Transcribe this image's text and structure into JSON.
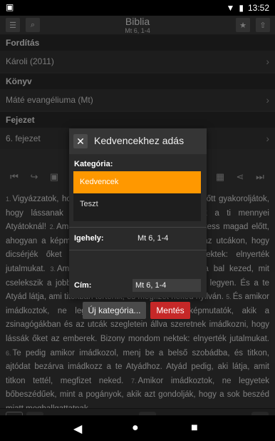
{
  "status_bar": {
    "app_icon": "android-notification-icon",
    "time": "13:52"
  },
  "toolbar": {
    "title": "Biblia",
    "subtitle": "Mt 6, 1-4"
  },
  "sections": [
    {
      "header": "Fordítás",
      "value": "Károli (2011)"
    },
    {
      "header": "Könyv",
      "value": "Máté evangéliuma (Mt)"
    },
    {
      "header": "Fejezet",
      "value": "6. fejezet"
    }
  ],
  "bible_text": [
    {
      "n": "1.",
      "t": "Vigyázzatok, hogy alamizsnátokat ne az emberek előtt gyakoroljátok, hogy lássanak titeket; különben nincs jutalmatok a ti mennyei Atyátoknál!"
    },
    {
      "n": "2.",
      "t": "Amikor tehát alamizsnát adsz, ne kürtöltess magad előtt, ahogyan a képmutatók teszik a zsinagógákban és az utcákon, hogy dicsérjék őket az emberek. Bizony mondom nektek: elnyerték jutalmukat."
    },
    {
      "n": "3.",
      "t": "Amikor te alamizsnát adsz, ne tudja a bal kezed, mit cselekszik a jobb kezed,"
    },
    {
      "n": "4.",
      "t": "hogy alamizsnád titokban legyen. És a te Atyád látja, ami titokban történik, és megfizet neked nyilván."
    },
    {
      "n": "5.",
      "t": "És amikor imádkoztok, ne legyetek olyanok, mint a képmutatók, akik a zsinagógákban és az utcák szegletein állva szeretnek imádkozni, hogy lássák őket az emberek. Bizony mondom nektek: elnyerték jutalmukat."
    },
    {
      "n": "6.",
      "t": "Te pedig amikor imádkozol, menj be a belső szobádba, és titkon, ajtódat bezárva imádkozz a te Atyádhoz. Atyád pedig, aki látja, amit titkon tettél, megfizet neked."
    },
    {
      "n": "7.",
      "t": "Amikor imádkoztok, ne legyetek bőbeszédűek, mint a pogányok, akik azt gondolják, hogy a sok beszéd miatt meghallgattatnak."
    }
  ],
  "dialog": {
    "title": "Kedvencekhez adás",
    "category_label": "Kategória:",
    "categories": [
      {
        "label": "Kedvencek",
        "selected": true
      },
      {
        "label": "Teszt",
        "selected": false
      }
    ],
    "verse_label": "Igehely:",
    "verse_value": "Mt 6, 1-4",
    "title_label": "Cím:",
    "title_value": "Mt 6, 1-4",
    "new_category_button": "Új kategória...",
    "save_button": "Mentés"
  },
  "colors": {
    "accent": "#ff9800",
    "save": "#c62828",
    "background": "#3a3a3a"
  }
}
